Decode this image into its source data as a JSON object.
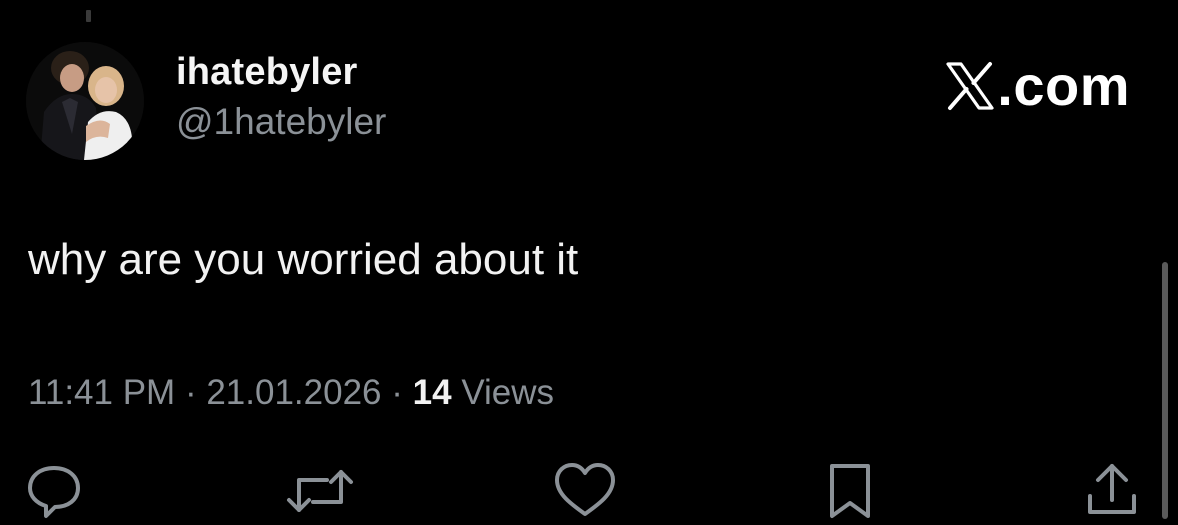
{
  "tweet": {
    "display_name": "ihatebyler",
    "handle": "@1hatebyler",
    "text": "why are you worried about it",
    "time": "11:41 PM",
    "date": "21.01.2026",
    "views_count": "14",
    "views_label": "Views",
    "separator": "·"
  },
  "brand": {
    "label": ".com",
    "icon": "x-logo-icon"
  },
  "actions": {
    "icons": [
      "reply-icon",
      "retweet-icon",
      "like-icon",
      "bookmark-icon",
      "share-icon"
    ]
  },
  "colors": {
    "background": "#000000",
    "primary_text": "#e7e9ea",
    "secondary_text": "#8b9197"
  }
}
